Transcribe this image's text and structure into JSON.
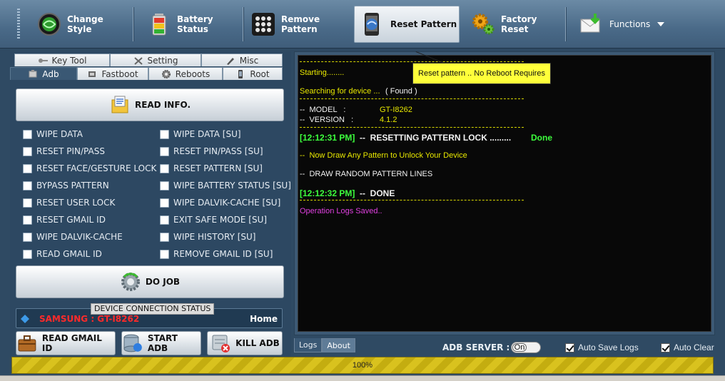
{
  "toolbar": {
    "buttons": [
      {
        "label": "Change Style",
        "icon": "globe-icon"
      },
      {
        "label": "Battery Status",
        "icon": "battery-icon"
      },
      {
        "label": "Remove Pattern",
        "icon": "keypad-icon"
      },
      {
        "label": "Reset Pattern",
        "icon": "phone-reset-icon",
        "active": true
      },
      {
        "label": "Factory Reset",
        "icon": "gears-icon"
      },
      {
        "label": "Functions",
        "icon": "envelope-arrow-icon",
        "dropdown": true
      }
    ]
  },
  "tabs": {
    "row1": [
      {
        "label": "Key Tool",
        "icon": "key-icon"
      },
      {
        "label": "Setting",
        "icon": "tools-icon"
      },
      {
        "label": "Misc",
        "icon": "pen-icon"
      }
    ],
    "row2": [
      {
        "label": "Adb",
        "icon": "usb-icon",
        "active": true
      },
      {
        "label": "Fastboot",
        "icon": "chip-icon"
      },
      {
        "label": "Reboots",
        "icon": "gear-icon"
      },
      {
        "label": "Root",
        "icon": "phone-icon"
      }
    ]
  },
  "read_info_label": "READ INFO.",
  "options_left": [
    "WIPE DATA",
    "RESET PIN/PASS",
    "RESET FACE/GESTURE LOCK",
    "BYPASS PATTERN",
    "RESET USER LOCK",
    "RESET GMAIL ID",
    "WIPE DALVIK-CACHE",
    "READ GMAIL ID"
  ],
  "options_right": [
    "WIPE DATA [SU]",
    "RESET PIN/PASS [SU]",
    "RESET PATTERN [SU]",
    "WIPE BATTERY STATUS [SU]",
    "WIPE DALVIK-CACHE [SU]",
    "EXIT SAFE MODE [SU]",
    "WIPE HISTORY [SU]",
    "REMOVE GMAIL ID [SU]"
  ],
  "do_job_label": "DO JOB",
  "device_status": {
    "title": "DEVICE CONNECTION STATUS",
    "value": "SAMSUNG : GT-I8262",
    "home": "Home"
  },
  "bottom_buttons": [
    {
      "label": "READ GMAIL ID",
      "icon": "briefcase-icon"
    },
    {
      "label": "START ADB",
      "icon": "database-icon"
    },
    {
      "label": "KILL ADB",
      "icon": "server-x-icon"
    }
  ],
  "log": {
    "starting": "Starting........",
    "searching": "Searching for device ...",
    "found": "( Found )",
    "model_label": "--  MODEL   :",
    "model_value": "GT-I8262",
    "version_label": "--  VERSION   :",
    "version_value": "4.1.2",
    "ts1": "[12:12:31 PM]",
    "resetting": "--  RESETTING PATTERN LOCK .........",
    "done1": "Done",
    "draw_any": "--  Now Draw Any Pattern to Unlock Your Device",
    "draw_random": "--  DRAW RANDOM PATTERN LINES",
    "ts2": "[12:12:32 PM]",
    "done2": "--  DONE",
    "saved": "Operation Logs Saved.."
  },
  "tooltip": "Reset pattern .. No Reboot Requires",
  "log_tabs": [
    "Logs",
    "About"
  ],
  "adb_server_label": "ADB SERVER :",
  "adb_toggle": "On",
  "auto_save_logs": "Auto Save Logs",
  "auto_clear": "Auto Clear",
  "progress": {
    "percent": 100,
    "label": "100%"
  }
}
